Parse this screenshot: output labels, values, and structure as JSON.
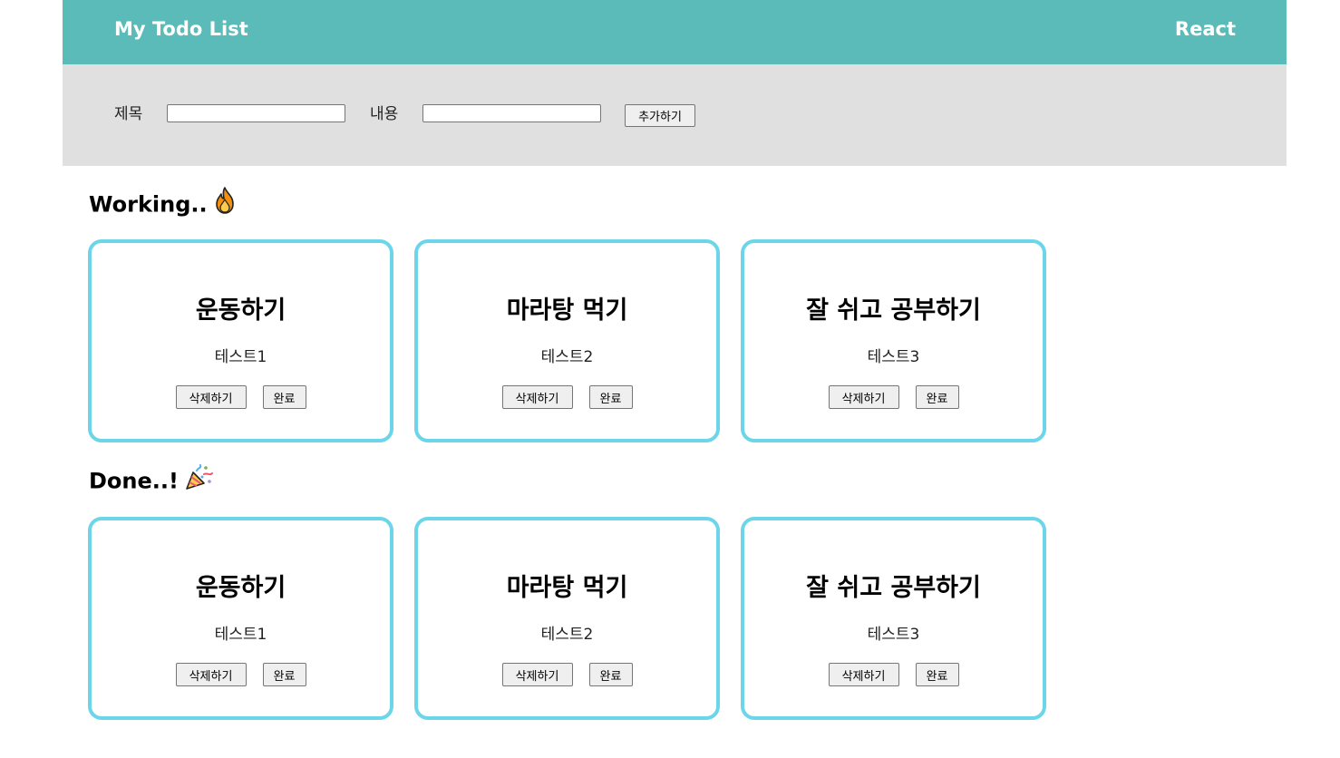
{
  "header": {
    "title": "My Todo List",
    "brand": "React"
  },
  "form": {
    "title_label": "제목",
    "title_value": "",
    "content_label": "내용",
    "content_value": "",
    "add_label": "추가하기"
  },
  "sections": {
    "working": {
      "title": "Working..",
      "icon": "fire-icon",
      "cards": [
        {
          "title": "운동하기",
          "body": "테스트1",
          "delete_label": "삭제하기",
          "complete_label": "완료"
        },
        {
          "title": "마라탕 먹기",
          "body": "테스트2",
          "delete_label": "삭제하기",
          "complete_label": "완료"
        },
        {
          "title": "잘 쉬고 공부하기",
          "body": "테스트3",
          "delete_label": "삭제하기",
          "complete_label": "완료"
        }
      ]
    },
    "done": {
      "title": "Done..!",
      "icon": "party-popper-icon",
      "cards": [
        {
          "title": "운동하기",
          "body": "테스트1",
          "delete_label": "삭제하기",
          "complete_label": "완료"
        },
        {
          "title": "마라탕 먹기",
          "body": "테스트2",
          "delete_label": "삭제하기",
          "complete_label": "완료"
        },
        {
          "title": "잘 쉬고 공부하기",
          "body": "테스트3",
          "delete_label": "삭제하기",
          "complete_label": "완료"
        }
      ]
    }
  },
  "colors": {
    "header_bg": "#5bbbb9",
    "form_bg": "#e0e0e0",
    "card_border": "#6dd5ea"
  }
}
